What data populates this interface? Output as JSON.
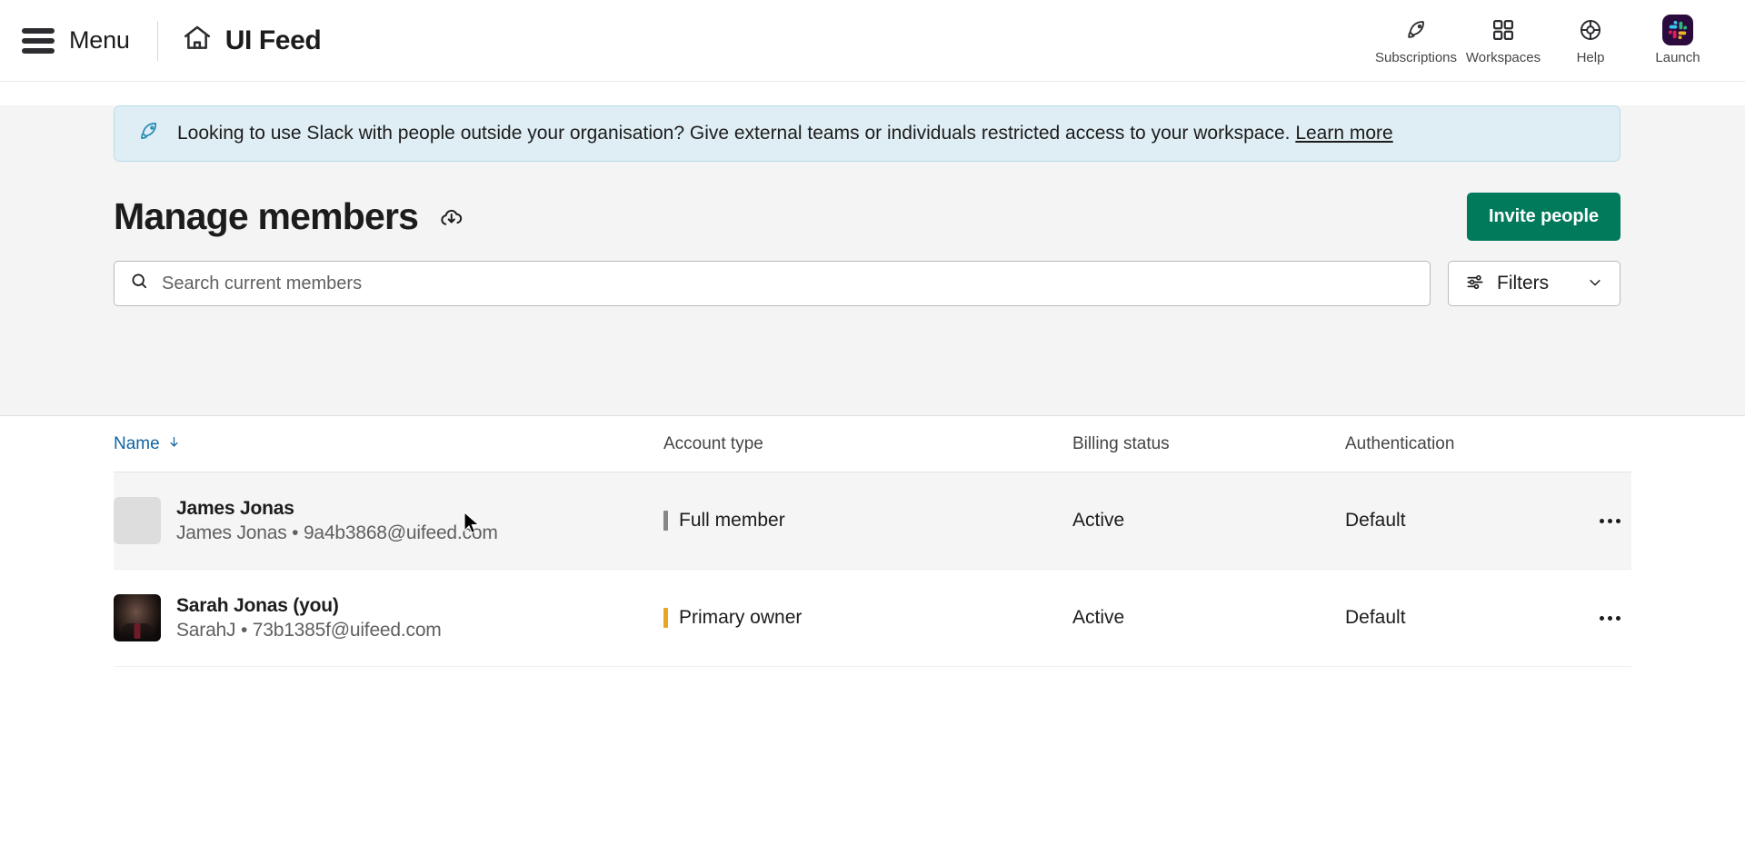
{
  "topnav": {
    "menu_label": "Menu",
    "menu_icon": "hamburger-icon",
    "home_icon": "home-icon",
    "brand_title": "UI Feed",
    "items": [
      {
        "label": "Subscriptions",
        "icon": "rocket-icon"
      },
      {
        "label": "Workspaces",
        "icon": "grid-squares-icon"
      },
      {
        "label": "Help",
        "icon": "lifebuoy-icon"
      },
      {
        "label": "Launch",
        "icon": "slack-logo-icon"
      }
    ]
  },
  "banner": {
    "icon": "rocket-icon",
    "text": "Looking to use Slack with people outside your organisation? Give external teams or individuals restricted access to your workspace.",
    "link_label": "Learn more",
    "bg_color": "#dfeef4",
    "border_color": "#b9dce8"
  },
  "page": {
    "title": "Manage members",
    "download_icon": "cloud-download-icon",
    "invite_button_label": "Invite people",
    "invite_button_color": "#007a5a"
  },
  "search": {
    "icon": "search-icon",
    "value": "",
    "placeholder": "Search current members"
  },
  "filters": {
    "label": "Filters",
    "icon": "sliders-icon",
    "chevron": "chevron-down-icon"
  },
  "table": {
    "headers": {
      "name": "Name",
      "sort_icon": "arrow-down-icon",
      "sort_color": "#1264a3",
      "account_type": "Account type",
      "billing_status": "Billing status",
      "authentication": "Authentication"
    },
    "rows": [
      {
        "name": "James Jonas",
        "subtitle": "James Jonas • 9a4b3868@uifeed.com",
        "avatar_type": "placeholder",
        "account_type": "Full member",
        "account_type_color": "#868686",
        "billing_status": "Active",
        "authentication": "Default",
        "menu_icon": "overflow-menu-icon",
        "hovered": true
      },
      {
        "name": "Sarah Jonas (you)",
        "subtitle": "SarahJ • 73b1385f@uifeed.com",
        "avatar_type": "photo",
        "account_type": "Primary owner",
        "account_type_color": "#e8a723",
        "billing_status": "Active",
        "authentication": "Default",
        "menu_icon": "overflow-menu-icon",
        "hovered": false
      }
    ]
  }
}
